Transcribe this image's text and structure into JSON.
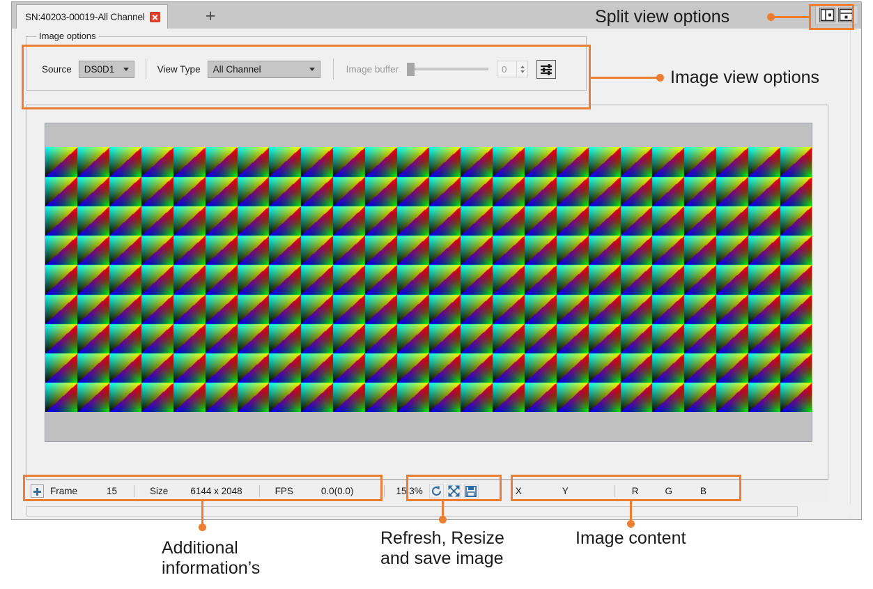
{
  "window": {
    "tab": {
      "label": "SN:40203-00019-All Channel",
      "close_icon": "close-icon",
      "new_tab_label": "+"
    },
    "split_view": {
      "vertical_label": "split-vertical-icon",
      "horizontal_label": "split-horizontal-icon"
    }
  },
  "image_options": {
    "legend": "Image options",
    "source_label": "Source",
    "source_value": "DS0D1",
    "view_type_label": "View Type",
    "view_type_value": "All Channel",
    "image_buffer_label": "Image buffer",
    "image_buffer_value": "0",
    "settings_icon": "sliders-icon"
  },
  "status_bar": {
    "add_icon": "plus-icon",
    "frame_label": "Frame",
    "frame_value": "15",
    "size_label": "Size",
    "size_value": "6144 x 2048",
    "fps_label": "FPS",
    "fps_value": "0.0(0.0)",
    "zoom_value": "15.3%",
    "refresh_icon": "refresh-icon",
    "resize_icon": "fit-screen-icon",
    "save_icon": "save-icon",
    "x_label": "X",
    "x_value": "",
    "y_label": "Y",
    "y_value": "",
    "r_label": "R",
    "r_value": "",
    "g_label": "G",
    "g_value": "",
    "b_label": "B",
    "b_value": ""
  },
  "annotations": {
    "split_view": "Split view options",
    "image_view": "Image view options",
    "additional_info": "Additional\ninformation’s",
    "refresh_resize_save": "Refresh, Resize\nand save image",
    "image_content": "Image content"
  },
  "colors": {
    "accent": "#ED7D31",
    "tab_strip": "#c8c8c8",
    "panel": "#f0f0f0",
    "canvas_bg": "#c0c0c0",
    "close_red": "#e8412e"
  },
  "image_pattern": {
    "description": "RGB diagonal gradient test pattern tiles",
    "tiles_across": 24,
    "tiles_down": 9
  }
}
